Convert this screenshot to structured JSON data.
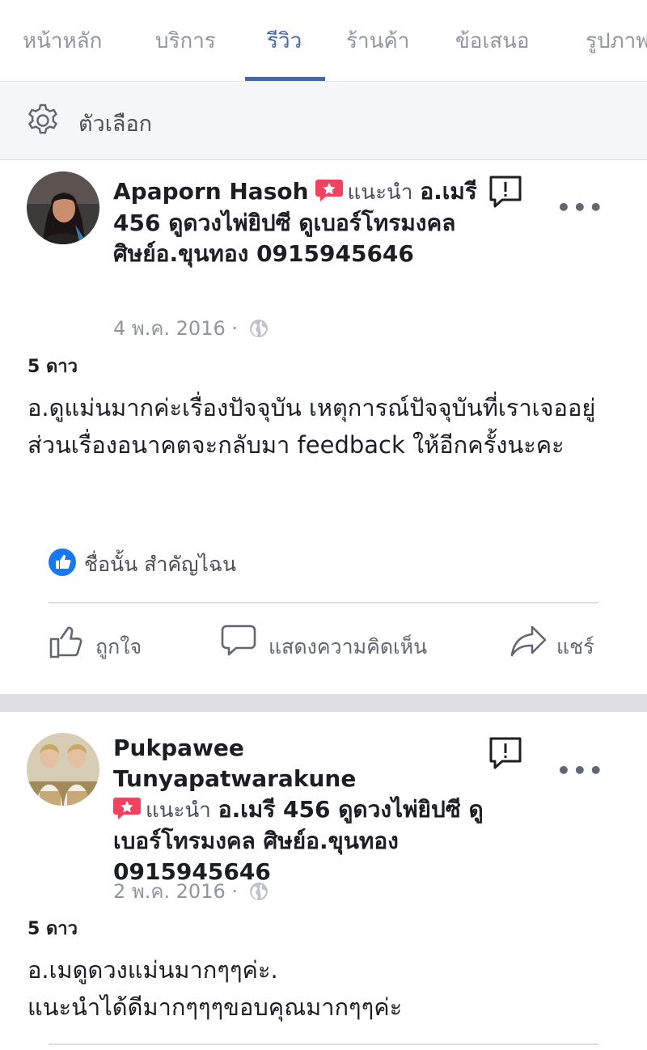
{
  "tabs": [
    {
      "label": "หน้าหลัก"
    },
    {
      "label": "บริการ"
    },
    {
      "label": "รีวิว",
      "active": true
    },
    {
      "label": "ร้านค้า"
    },
    {
      "label": "ข้อเสนอ"
    },
    {
      "label": "รูปภาพ"
    }
  ],
  "options": {
    "label": "ตัวเลือก",
    "icon": "gear-icon"
  },
  "reviews": [
    {
      "author": "Apaporn Hasoh",
      "recommends_label": "แนะนำ",
      "page_name": "อ.เมรี 456 ดูดวงไพ่ยิปซี ดูเบอร์โทรมงคล ศิษย์อ.ขุนทอง 0915945646",
      "date": "4 พ.ค. 2016",
      "separator": "·",
      "rating": "5 ดาว",
      "text": "อ.ดูแม่นมากค่ะเรื่องปัจจุบัน เหตุการณ์ปัจจุบันที่เราเจออยู่ ส่วนเรื่องอนาคตจะกลับมา feedback ให้อีกครั้งนะคะ",
      "likes_by": "ชื่อนั้น สำคัญไฉน",
      "more": "•••"
    },
    {
      "author": "Pukpawee Tunyapatwarakune",
      "recommends_label": "แนะนำ",
      "page_name": "อ.เมรี 456 ดูดวงไพ่ยิปซี ดูเบอร์โทรมงคล ศิษย์อ.ขุนทอง 0915945646",
      "date": "2 พ.ค. 2016",
      "separator": "·",
      "rating": "5 ดาว",
      "text_line1": "อ.เมดูดวงแม่นมากๆๆค่ะ.",
      "text_line2": "แนะนำได้ดีมากๆๆๆขอบคุณมากๆๆค่ะ",
      "more": "•••"
    }
  ],
  "actions": {
    "like": "ถูกใจ",
    "comment": "แสดงความคิดเห็น",
    "share": "แชร์"
  },
  "colors": {
    "accent": "#4267b2",
    "like_blue": "#1877f2",
    "recommend_red": "#f3425f",
    "muted": "#90949c"
  }
}
